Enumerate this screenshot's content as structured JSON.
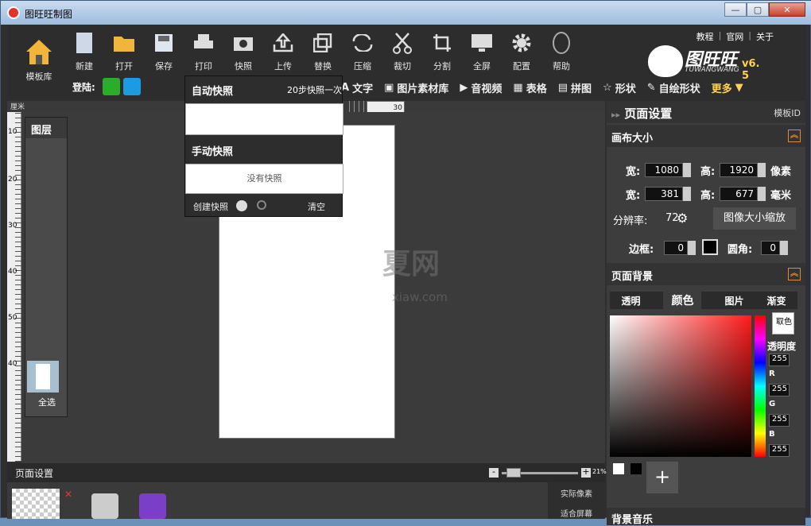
{
  "window": {
    "title": "图旺旺制图"
  },
  "toolbar": {
    "template_lib": "模板库",
    "buttons": [
      "新建",
      "打开",
      "保存",
      "打印",
      "快照",
      "上传",
      "替换",
      "压缩",
      "裁切",
      "分割",
      "全屏",
      "配置",
      "帮助"
    ]
  },
  "links": [
    "教程",
    "官网",
    "关于"
  ],
  "brand": {
    "name": "图旺旺",
    "sub": "TUWANGWANG",
    "version": "v6. 5"
  },
  "login": {
    "label": "登陆:"
  },
  "tools": [
    "文字",
    "图片素材库",
    "音视频",
    "表格",
    "拼图",
    "形状",
    "自绘形状"
  ],
  "more": "更多",
  "ruler": {
    "unit": "厘米",
    "top_num": "30",
    "left_nums": [
      "10",
      "20",
      "30",
      "40",
      "50",
      "40"
    ]
  },
  "layers": {
    "title": "图层",
    "select_all": "全选"
  },
  "snapshot": {
    "auto_title": "自动快照",
    "auto_note": "20步快照一次",
    "manual_title": "手动快照",
    "empty": "没有快照",
    "create": "创建快照",
    "clear": "清空"
  },
  "watermark": {
    "line1": "夏网",
    "line2": "xiaw.com"
  },
  "bottom": {
    "label": "页面设置",
    "zoom_pct": "21%",
    "actual": "实际像素",
    "fit": "适合屏幕"
  },
  "panel": {
    "title": "页面设置",
    "template_id": "模板ID",
    "canvas_size": "画布大小",
    "width_label": "宽:",
    "height_label": "高:",
    "width_px": "1080",
    "height_px": "1920",
    "px_unit": "像素",
    "width_mm": "381",
    "height_mm": "677",
    "mm_unit": "毫米",
    "resolution_label": "分辨率:",
    "resolution": "72",
    "scale_btn": "图像大小缩放",
    "border_label": "边框:",
    "border_val": "0",
    "radius_label": "圆角:",
    "radius_val": "0",
    "bg_title": "页面背景",
    "bg_tabs": [
      "透明",
      "颜色",
      "图片",
      "渐变"
    ],
    "pick": "取色",
    "alpha_label": "透明度",
    "alpha": "255",
    "r_label": "R",
    "r": "255",
    "g_label": "G",
    "g": "255",
    "b_label": "B",
    "b": "255",
    "music": "背景音乐"
  },
  "colors": {
    "accent": "#ffd34f",
    "orange": "#e58a2a"
  }
}
